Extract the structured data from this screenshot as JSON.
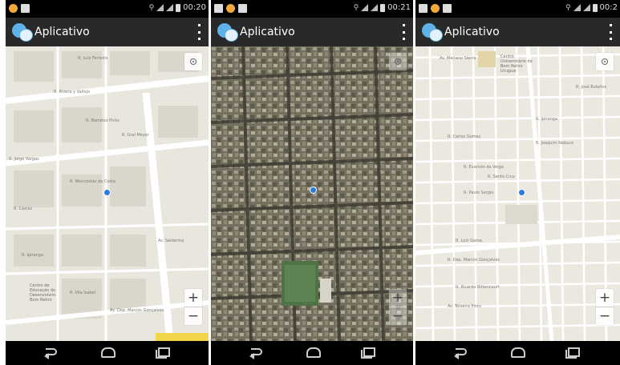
{
  "screens": [
    {
      "status_time": "00:20",
      "app_title": "Aplicativo",
      "map_type": "roadmap",
      "streets": [
        "R. Luiz Ferreira",
        "R. Rivera y Vallejo",
        "R. Barretos Pinto",
        "R. Gral Meyer",
        "R. Jorge Vargas",
        "R. Wenceslau da Costa",
        "R. Ipiranga",
        "Av. Dep. Marcos Gonçalves",
        "Av. Saldanha",
        "R. Caxias",
        "R. Vila Isabel"
      ],
      "poi": [
        "Centro de",
        "Educação do",
        "Desenvolvim.",
        "Bom Retiro"
      ],
      "colors": {
        "you": "#2e7bde",
        "road": "#ffffff",
        "land": "#e9e6de",
        "scale": "#f1d64b"
      }
    },
    {
      "status_time": "00:21",
      "app_title": "Aplicativo",
      "map_type": "satellite",
      "streets": [],
      "poi": [],
      "colors": {
        "you": "#2e7bde"
      }
    },
    {
      "status_time": "00:2",
      "app_title": "Aplicativo",
      "map_type": "roadmap",
      "streets": [
        "Av. Mariano Sierra",
        "R. José Bolaños",
        "R. Ipiranga",
        "R. Carlos Gomes",
        "R. Joaquim Nabuco",
        "R. Evaristo da Veiga",
        "R. Santa Cruz",
        "R. Paulo Sergio",
        "R. Luiz Gama",
        "R. Dep. Marcos Gonçalves",
        "R. Ricardo Bittencourt",
        "Av. Teixeira Pinto"
      ],
      "poi": [
        "Centro",
        "Universitário de",
        "Bom Retiro",
        "Uruguai"
      ],
      "colors": {
        "you": "#2e7bde"
      }
    }
  ],
  "icons": {
    "app": "chat-bubbles-icon",
    "overflow": "overflow-menu-icon",
    "location": "my-location-icon",
    "zoom_in": "+",
    "zoom_out": "−",
    "back": "back-icon",
    "home": "home-icon",
    "recent": "recent-apps-icon"
  }
}
